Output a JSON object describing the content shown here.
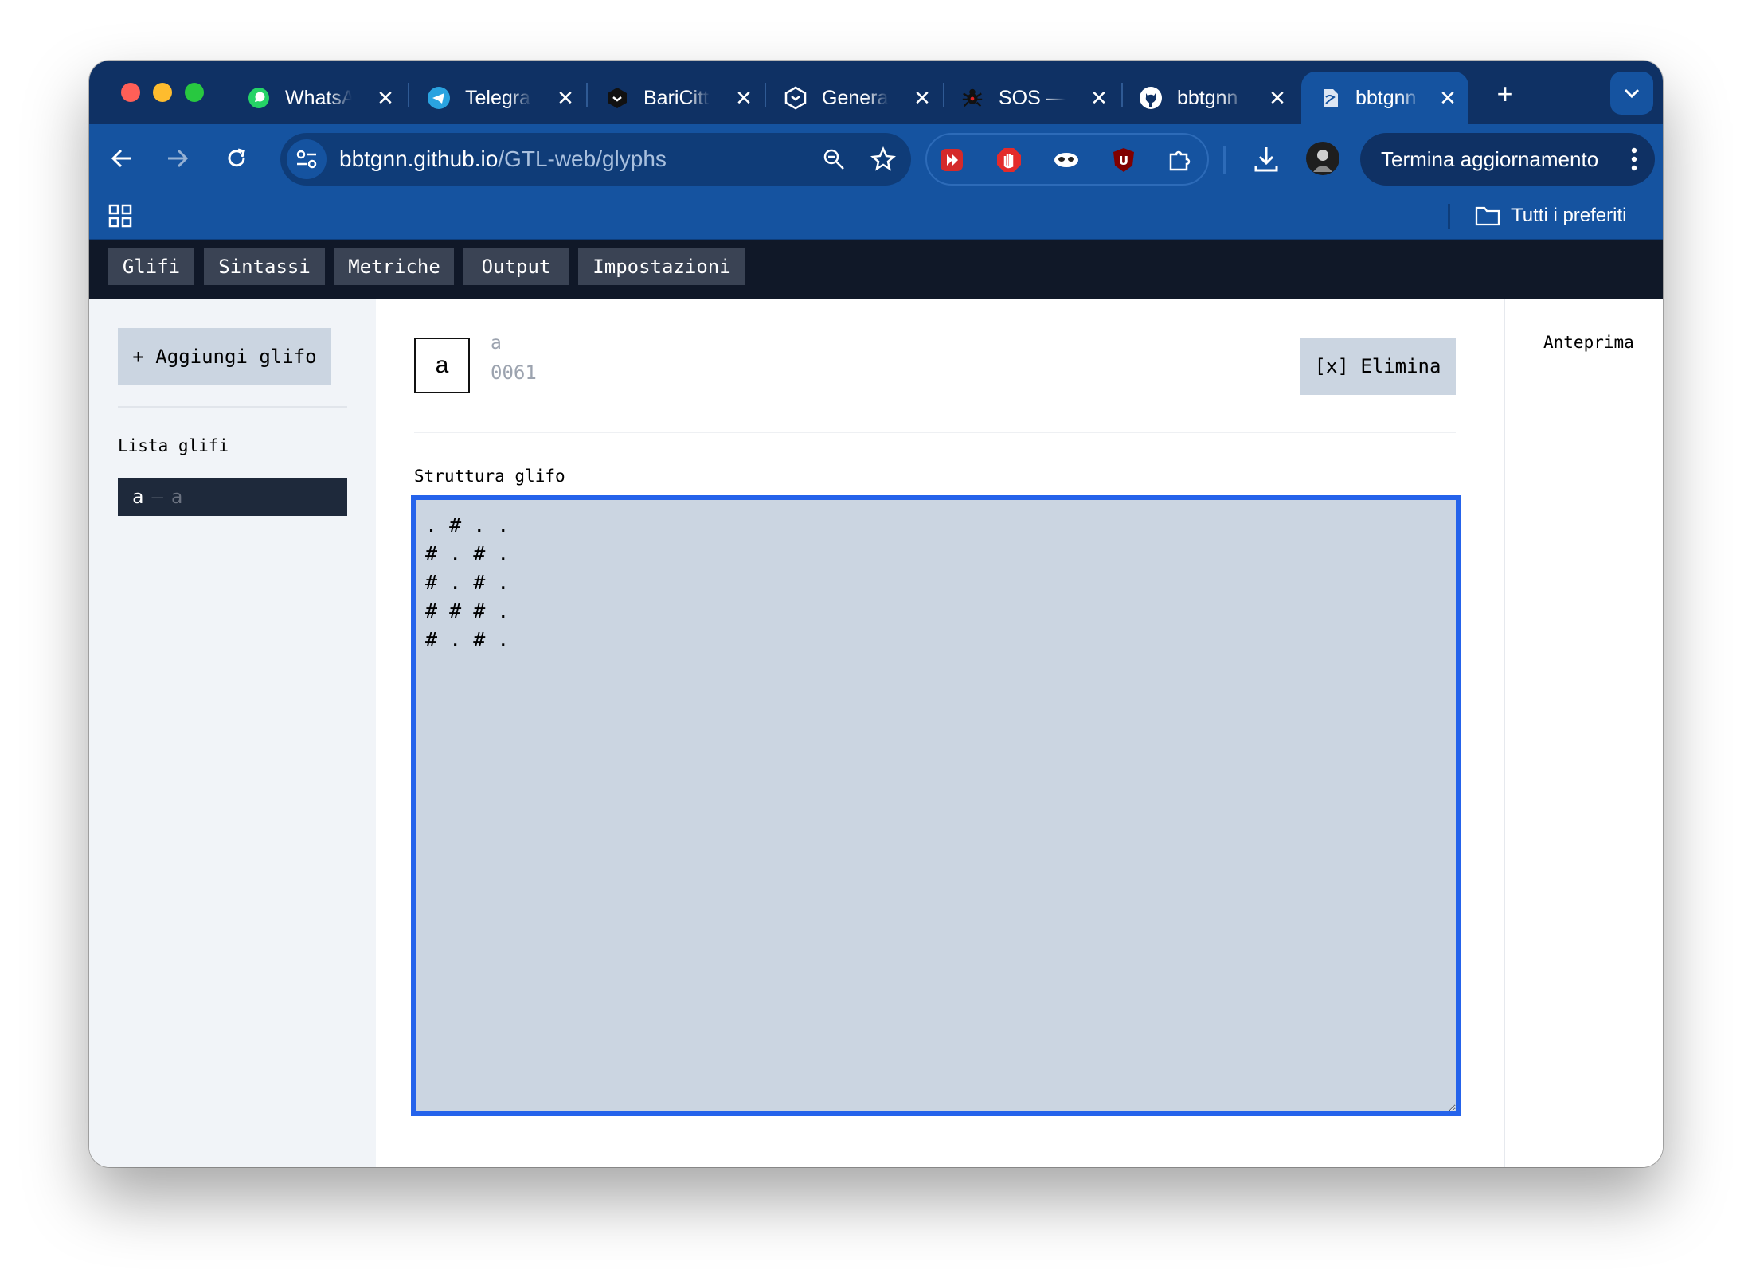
{
  "browser": {
    "tabs": [
      {
        "title": "WhatsApp",
        "icon": "whatsapp-icon"
      },
      {
        "title": "Telegram",
        "icon": "telegram-icon"
      },
      {
        "title": "BariCittà",
        "icon": "baricitta-icon"
      },
      {
        "title": "Generate",
        "icon": "hexagon-icon"
      },
      {
        "title": "SOS —",
        "icon": "bug-icon"
      },
      {
        "title": "bbtgnn",
        "icon": "github-icon"
      },
      {
        "title": "bbtgnn",
        "icon": "page-icon"
      }
    ],
    "tab_close": "✕",
    "new_tab": "+",
    "url_host": "bbtgnn.github.io",
    "url_path": "/GTL-web/glyphs",
    "update_label": "Termina aggiornamento",
    "bookmarks_label": "Tutti i preferiti",
    "colors": {
      "tabstrip": "#0f3164",
      "toolbar": "#1553a0",
      "nav": "#101828"
    }
  },
  "nav": {
    "items": [
      "Glifi",
      "Sintassi",
      "Metriche",
      "Output",
      "Impostazioni"
    ]
  },
  "sidebar": {
    "add_label": "+ Aggiungi glifo",
    "list_title": "Lista glifi",
    "glyphs": [
      {
        "char": "a",
        "name": "a"
      }
    ],
    "separator": "—"
  },
  "editor": {
    "glyph_char": "a",
    "glyph_name": "a",
    "glyph_code": "0061",
    "delete_label": "[x] Elimina",
    "structure_label": "Struttura glifo",
    "structure": ". # . .\n# . # .\n# . # .\n# # # .\n# . # ."
  },
  "preview": {
    "title": "Anteprima"
  }
}
